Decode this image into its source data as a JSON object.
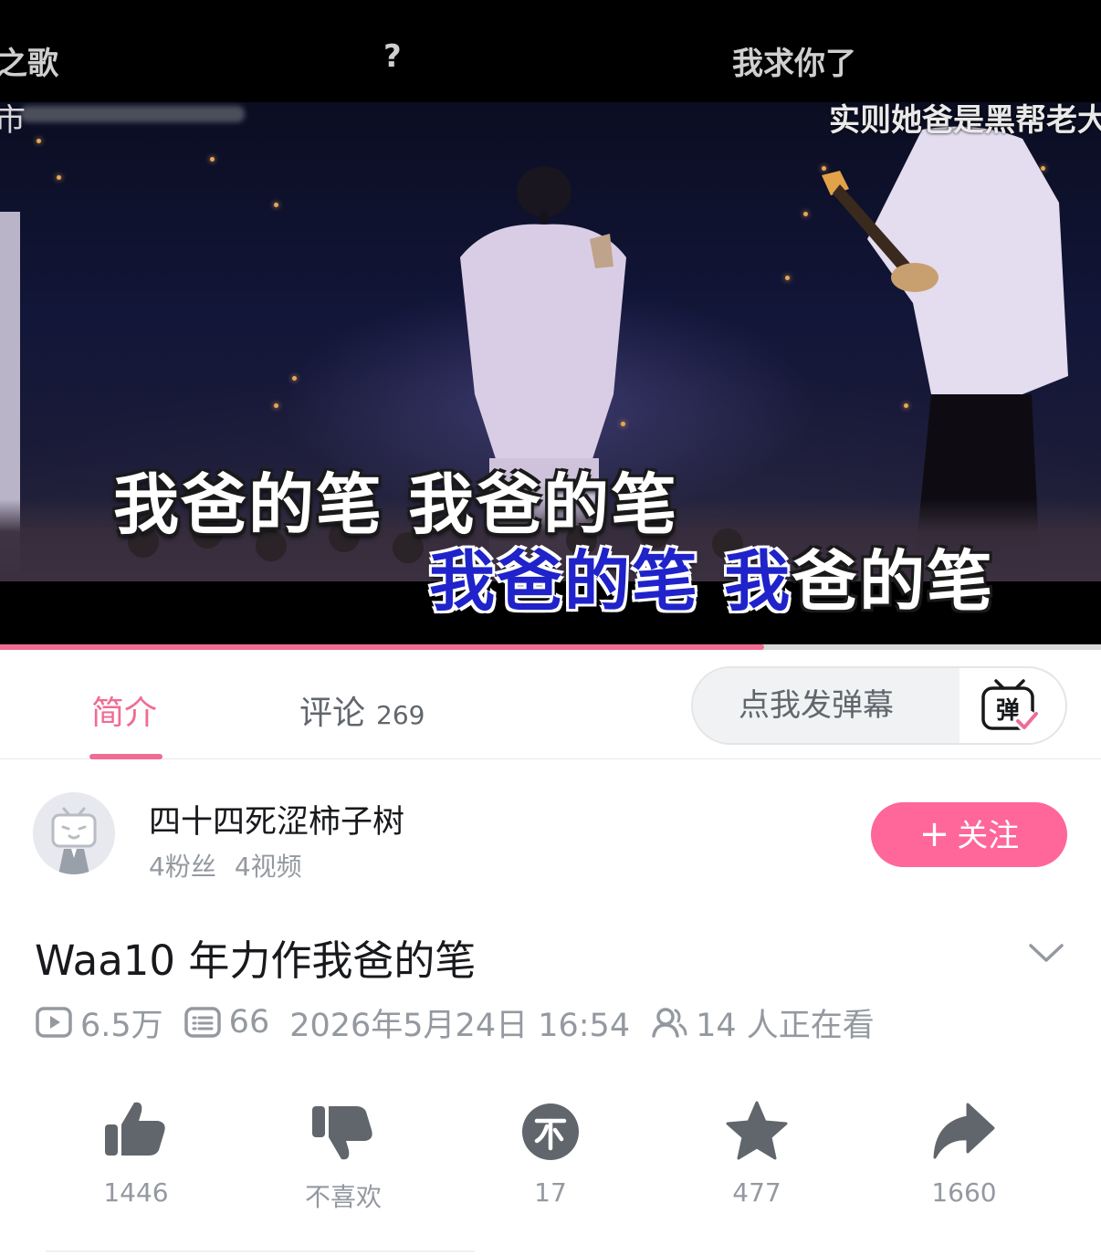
{
  "player": {
    "top_subtitles": [
      "之歌",
      "?",
      "我求你了"
    ],
    "scrolling_subtitle": "实则她爸是黑帮老大",
    "scrolling_subtitle_left": "市",
    "lyric_line_1": "我爸的笔 我爸的笔",
    "lyric_line_2_sung": "我爸的笔 我",
    "lyric_line_2_unsung": "爸的笔",
    "progress": 0.694
  },
  "tabs": [
    {
      "label": "简介",
      "active": true
    },
    {
      "label": "评论",
      "count": "269",
      "active": false
    }
  ],
  "danmaku": {
    "placeholder": "点我发弹幕",
    "toggle_icon": "danmaku-toggle-icon",
    "toggle_glyph": "弹"
  },
  "uploader": {
    "name": "四十四死涩柿子树",
    "fans": "4粉丝",
    "videos": "4视频",
    "follow_label": "关注",
    "follow_icon": "+"
  },
  "video": {
    "title": "Waa10 年力作我爸的笔",
    "views": "6.5万",
    "danmaku_count": "66",
    "date": "2026年5月24日 16:54",
    "watching": "14 人正在看"
  },
  "actions": [
    {
      "icon": "like-icon",
      "label": "1446"
    },
    {
      "icon": "dislike-icon",
      "label": "不喜欢"
    },
    {
      "icon": "coin-icon",
      "label": "17"
    },
    {
      "icon": "favorite-icon",
      "label": "477"
    },
    {
      "icon": "share-icon",
      "label": "1660"
    }
  ],
  "colors": {
    "accent": "#ef6c93",
    "follow_button": "#ff6699",
    "secondary_text": "#9499a0",
    "icon_gray": "#61666d",
    "lyric_sung": "#1f23c9"
  }
}
